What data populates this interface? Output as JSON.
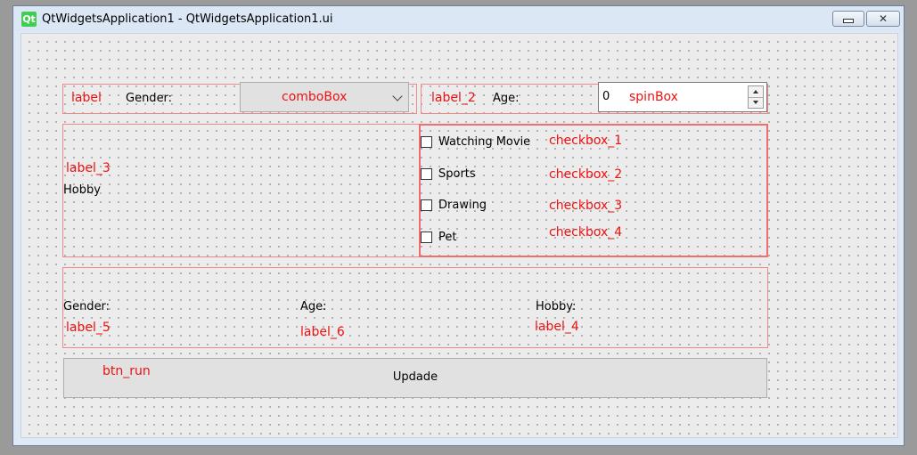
{
  "window": {
    "title": "QtWidgetsApplication1 - QtWidgetsApplication1.ui",
    "logo_text": "Qt"
  },
  "row1": {
    "label_name": "label",
    "gender_label": "Gender:",
    "combo_name": "comboBox",
    "label2_name": "label_2",
    "age_label": "Age:",
    "spin_value": "0",
    "spin_name": "spinBox"
  },
  "hobby": {
    "label3_name": "label_3",
    "hobby_label": "Hobby",
    "checkboxes": [
      {
        "text": "Watching Movie",
        "name": "checkbox_1",
        "checked": false
      },
      {
        "text": "Sports",
        "name": "checkbox_2",
        "checked": false
      },
      {
        "text": "Drawing",
        "name": "checkbox_3",
        "checked": false
      },
      {
        "text": "Pet",
        "name": "checkbox_4",
        "checked": false
      }
    ]
  },
  "result": {
    "gender_label": "Gender:",
    "label5_name": "label_5",
    "age_label": "Age:",
    "label6_name": "label_6",
    "hobby_label": "Hobby:",
    "label4_name": "label_4"
  },
  "button": {
    "name": "btn_run",
    "label": "Updade"
  },
  "colors": {
    "annotation": "#ee1111",
    "frame": "#f08a8a",
    "qt_green": "#41cd52"
  }
}
